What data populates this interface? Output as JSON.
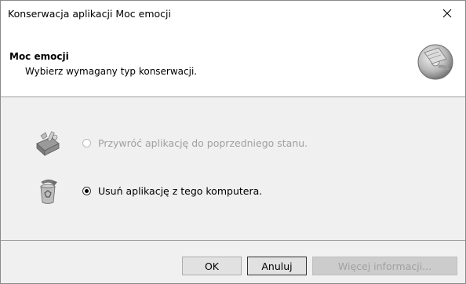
{
  "window": {
    "title": "Konserwacja aplikacji Moc emocji"
  },
  "header": {
    "title": "Moc emocji",
    "subtitle": "Wybierz wymagany typ konserwacji."
  },
  "options": [
    {
      "label": "Przywróć aplikację do poprzedniego stanu.",
      "icon": "toolbox-icon",
      "enabled": false,
      "selected": false
    },
    {
      "label": "Usuń aplikację z tego komputera.",
      "icon": "recycle-bin-icon",
      "enabled": true,
      "selected": true
    }
  ],
  "buttons": {
    "ok": "OK",
    "cancel": "Anuluj",
    "more_info": "Więcej informacji..."
  },
  "colors": {
    "content_bg": "#f0f0f0",
    "disabled_text": "#a0a0a0",
    "accent": "#0078d7"
  }
}
